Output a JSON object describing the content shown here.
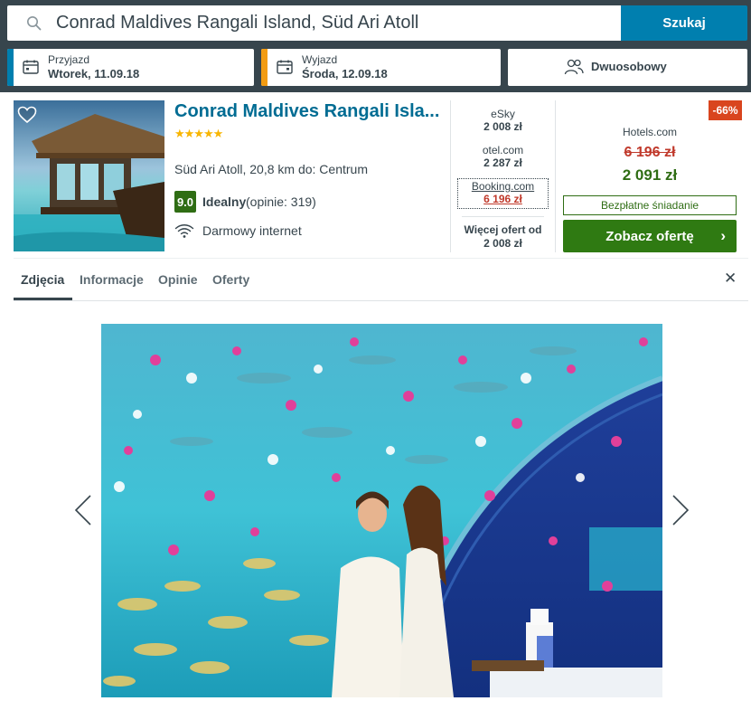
{
  "search": {
    "query": "Conrad Maldives Rangali Island, Süd Ari Atoll",
    "button_label": "Szukaj"
  },
  "dates": {
    "checkin_label": "Przyjazd",
    "checkin_value": "Wtorek, 11.09.18",
    "checkout_label": "Wyjazd",
    "checkout_value": "Środa, 12.09.18"
  },
  "room": {
    "type": "Dwuosobowy"
  },
  "hotel": {
    "name": "Conrad Maldives Rangali Isla...",
    "stars": "★★★★★",
    "location": "Süd Ari Atoll, 20,8 km do: Centrum",
    "rating_score": "9.0",
    "rating_label": "Idealny",
    "rating_count": "(opinie: 319)",
    "amenity": "Darmowy internet"
  },
  "offers": [
    {
      "site": "eSky",
      "price": "2 008 zł"
    },
    {
      "site": "otel.com",
      "price": "2 287 zł"
    },
    {
      "site": "Booking.com",
      "price": "6 196 zł"
    }
  ],
  "more_offers": {
    "line1": "Więcej ofert od",
    "line2": "2 008 zł"
  },
  "deal": {
    "discount": "-66%",
    "site": "Hotels.com",
    "old_price": "6 196 zł",
    "new_price": "2 091 zł",
    "perk": "Bezpłatne śniadanie",
    "cta": "Zobacz ofertę"
  },
  "tabs": [
    {
      "label": "Zdjęcia",
      "active": true
    },
    {
      "label": "Informacje",
      "active": false
    },
    {
      "label": "Opinie",
      "active": false
    },
    {
      "label": "Oferty",
      "active": false
    }
  ],
  "icons": {
    "search": "search-icon",
    "calendar": "calendar-icon",
    "people": "people-icon",
    "heart": "heart-icon",
    "wifi": "wifi-icon",
    "close": "close-icon",
    "prev": "chevron-left-icon",
    "next": "chevron-right-icon"
  },
  "colors": {
    "topbar": "#37454d",
    "search_button": "#007faf",
    "checkin_accent": "#007faf",
    "checkout_accent": "#f39c12",
    "rating_badge": "#2f6d14",
    "cta": "#2f7a12",
    "discount": "#d9451e",
    "link": "#006c93"
  }
}
